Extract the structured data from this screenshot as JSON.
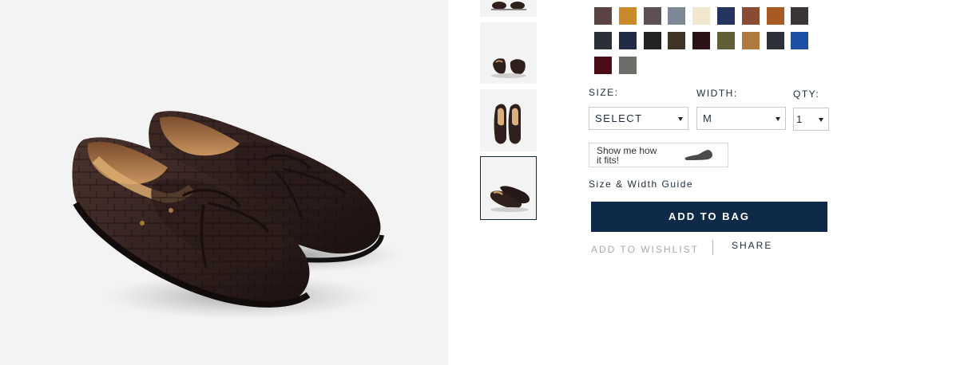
{
  "product": {
    "main_image_alt": "shoe-photo",
    "colors": {
      "swatches": [
        {
          "name": "swatch-1",
          "color": "#5a4440"
        },
        {
          "name": "swatch-2",
          "color": "#c98a2c"
        },
        {
          "name": "swatch-3",
          "color": "#5d5052"
        },
        {
          "name": "swatch-4",
          "color": "#7d8796"
        },
        {
          "name": "swatch-5",
          "color": "#f3e6cf"
        },
        {
          "name": "swatch-6",
          "color": "#23355e"
        },
        {
          "name": "swatch-7",
          "color": "#8a4b33"
        },
        {
          "name": "swatch-8",
          "color": "#a85a23"
        },
        {
          "name": "swatch-9",
          "color": "#3a3439"
        },
        {
          "name": "swatch-10",
          "color": "#2b3036"
        },
        {
          "name": "swatch-11",
          "color": "#1f2a44"
        },
        {
          "name": "swatch-12",
          "color": "#222222"
        },
        {
          "name": "swatch-13",
          "color": "#3f3526"
        },
        {
          "name": "swatch-14",
          "color": "#2a1216"
        },
        {
          "name": "swatch-15",
          "color": "#5f5e34"
        },
        {
          "name": "swatch-16",
          "color": "#b07a3e"
        },
        {
          "name": "swatch-17",
          "color": "#2d3036"
        },
        {
          "name": "swatch-18",
          "color": "#1d4fa3"
        },
        {
          "name": "swatch-19",
          "color": "#4d0d17"
        },
        {
          "name": "swatch-20",
          "color": "#6d6e6a"
        }
      ]
    },
    "options": {
      "size_label": "SIZE:",
      "size_value": "SELECT",
      "width_label": "WIDTH:",
      "width_value": "M",
      "qty_label": "QTY:",
      "qty_value": "1"
    },
    "fit": {
      "text": "Show me how it fits!"
    },
    "size_guide_label": "Size & Width Guide",
    "add_to_bag_label": "ADD TO BAG",
    "wishlist_label": "ADD TO WISHLIST",
    "share_label": "SHARE"
  },
  "colors": {
    "accent": "#0e2a47",
    "muted": "#a9a9a9",
    "panel_bg": "#f3f3f3"
  }
}
